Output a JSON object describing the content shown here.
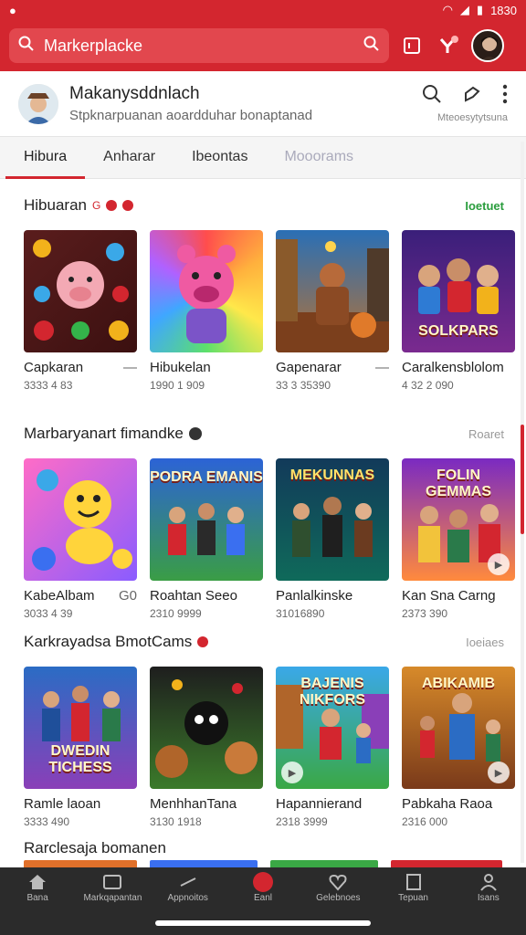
{
  "status": {
    "time": "1830"
  },
  "search": {
    "text": "Markerplacke"
  },
  "profile": {
    "name": "Makanysddnlach",
    "subtitle": "Stpknarpuanan aoardduhar bonaptanad",
    "caption": "Mteoesytytsuna"
  },
  "tabs": [
    {
      "label": "Hibura"
    },
    {
      "label": "Anharar"
    },
    {
      "label": "Ibeontas"
    },
    {
      "label": "Mooorams"
    }
  ],
  "sections": [
    {
      "title": "Hibuaran",
      "mark": "G",
      "link": "Ioetuet",
      "cards": [
        {
          "title": "Capkaran",
          "extra": "—",
          "sub": "3333 4 83"
        },
        {
          "title": "Hibukelan",
          "extra": "",
          "sub": "1990 1 909"
        },
        {
          "title": "Gapenarar",
          "extra": "—",
          "sub": "33 3 35390"
        },
        {
          "title": "Caralkensblolom",
          "extra": "",
          "sub": "4 32 2 090",
          "brand": "SOLKPARS"
        }
      ]
    },
    {
      "title": "Marbaryanart fimandke",
      "mark": "",
      "link": "Roaret",
      "cards": [
        {
          "title": "KabeAlbam",
          "extra": "G0",
          "sub": "3033 4 39"
        },
        {
          "title": "Roahtan Seeo",
          "extra": "",
          "sub": "2310 9999",
          "brand": "PODRA EMANIS"
        },
        {
          "title": "Panlalkinske",
          "extra": "",
          "sub": "31016890",
          "brand": "MEKUNNAS"
        },
        {
          "title": "Kan Sna Carng",
          "extra": "",
          "sub": "2373 390",
          "brand": "FOLIN GEMMAS"
        }
      ]
    },
    {
      "title": "Karkrayadsa BmotCams",
      "mark": "",
      "link": "Ioeiaes",
      "cards": [
        {
          "title": "Ramle laoan",
          "extra": "",
          "sub": "3333 490",
          "brand": "DWEDIN TICHESS"
        },
        {
          "title": "MenhhanTana",
          "extra": "",
          "sub": "3130 1918"
        },
        {
          "title": "Hapannierand",
          "extra": "",
          "sub": "2318 3999",
          "brand": "BAJENIS NIKFORS"
        },
        {
          "title": "Pabkaha Raoa",
          "extra": "",
          "sub": "2316 000",
          "brand": "ABIKAMIB"
        }
      ]
    }
  ],
  "next_section": {
    "title": "Rarclesaja bomanen"
  },
  "nav": [
    {
      "label": "Bana"
    },
    {
      "label": "Markqapantan"
    },
    {
      "label": "Appnoitos"
    },
    {
      "label": "Eanl"
    },
    {
      "label": "Gelebnoes"
    },
    {
      "label": "Tepuan"
    },
    {
      "label": "Isans"
    }
  ],
  "colors": {
    "accent": "#d3262f",
    "link_green": "#2a9d3d",
    "nav_bg": "#2b2b2b"
  }
}
